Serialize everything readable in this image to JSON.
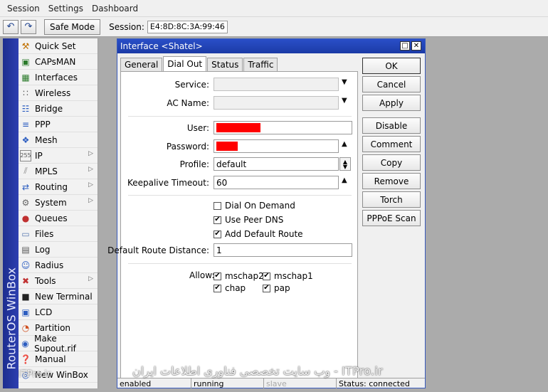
{
  "menu": [
    "Session",
    "Settings",
    "Dashboard"
  ],
  "toolbar": {
    "undo_icon": "undo-icon",
    "redo_icon": "redo-icon",
    "safe_mode": "Safe Mode",
    "session_label": "Session:",
    "session_value": "E4:8D:8C:3A:99:46"
  },
  "sidebar": {
    "brand": "RouterOS WinBox",
    "items": [
      {
        "label": "Quick Set",
        "icon": "quick-set-icon",
        "sub": false
      },
      {
        "label": "CAPsMAN",
        "icon": "capsman-icon",
        "sub": false
      },
      {
        "label": "Interfaces",
        "icon": "interfaces-icon",
        "sub": false
      },
      {
        "label": "Wireless",
        "icon": "wireless-icon",
        "sub": false
      },
      {
        "label": "Bridge",
        "icon": "bridge-icon",
        "sub": false
      },
      {
        "label": "PPP",
        "icon": "ppp-icon",
        "sub": false
      },
      {
        "label": "Mesh",
        "icon": "mesh-icon",
        "sub": false
      },
      {
        "label": "IP",
        "icon": "ip-icon",
        "sub": true
      },
      {
        "label": "MPLS",
        "icon": "mpls-icon",
        "sub": true
      },
      {
        "label": "Routing",
        "icon": "routing-icon",
        "sub": true
      },
      {
        "label": "System",
        "icon": "system-icon",
        "sub": true
      },
      {
        "label": "Queues",
        "icon": "queues-icon",
        "sub": false
      },
      {
        "label": "Files",
        "icon": "files-icon",
        "sub": false
      },
      {
        "label": "Log",
        "icon": "log-icon",
        "sub": false
      },
      {
        "label": "Radius",
        "icon": "radius-icon",
        "sub": false
      },
      {
        "label": "Tools",
        "icon": "tools-icon",
        "sub": true
      },
      {
        "label": "New Terminal",
        "icon": "terminal-icon",
        "sub": false
      },
      {
        "label": "LCD",
        "icon": "lcd-icon",
        "sub": false
      },
      {
        "label": "Partition",
        "icon": "partition-icon",
        "sub": false
      },
      {
        "label": "Make Supout.rif",
        "icon": "supout-icon",
        "sub": false
      },
      {
        "label": "Manual",
        "icon": "manual-icon",
        "sub": false
      },
      {
        "label": "New WinBox",
        "icon": "winbox-icon",
        "sub": false
      }
    ]
  },
  "dialog": {
    "title": "Interface <Shatel>",
    "tabs": [
      "General",
      "Dial Out",
      "Status",
      "Traffic"
    ],
    "active_tab": "Dial Out",
    "fields": {
      "service_label": "Service:",
      "service_value": "",
      "ac_name_label": "AC Name:",
      "ac_name_value": "",
      "user_label": "User:",
      "password_label": "Password:",
      "profile_label": "Profile:",
      "profile_value": "default",
      "keepalive_label": "Keepalive Timeout:",
      "keepalive_value": "60",
      "default_route_distance_label": "Default Route Distance:",
      "default_route_distance_value": "1",
      "allow_label": "Allow:"
    },
    "checkboxes": [
      {
        "label": "Dial On Demand",
        "checked": false
      },
      {
        "label": "Use Peer DNS",
        "checked": true
      },
      {
        "label": "Add Default Route",
        "checked": true
      }
    ],
    "allow": [
      {
        "label": "mschap2",
        "checked": true
      },
      {
        "label": "mschap1",
        "checked": true
      },
      {
        "label": "chap",
        "checked": true
      },
      {
        "label": "pap",
        "checked": true
      }
    ],
    "buttons": [
      "OK",
      "Cancel",
      "Apply",
      "Disable",
      "Comment",
      "Copy",
      "Remove",
      "Torch",
      "PPPoE Scan"
    ],
    "status": [
      "enabled",
      "running",
      "slave",
      "Status: connected"
    ]
  },
  "watermark": "وب سایت تخصصی فناوری اطلاعات ایران - ITPro.ir",
  "watermark_small": "ITPro.ir"
}
